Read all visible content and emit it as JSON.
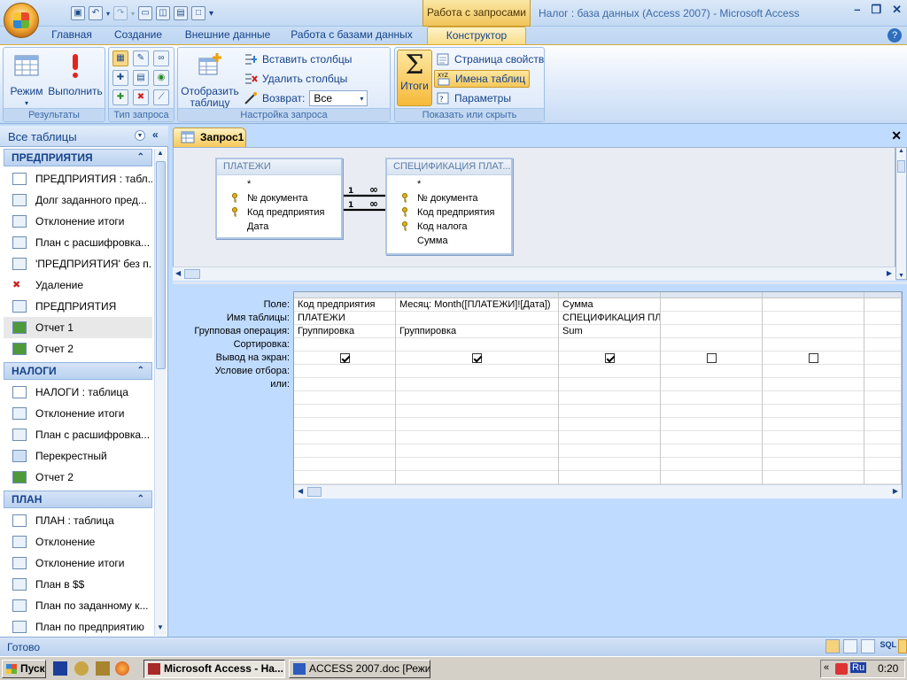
{
  "title_bar": {
    "context_tab": "Работа с запросами",
    "window_title": "Налог : база данных (Access 2007) - Microsoft Access"
  },
  "tabs": [
    {
      "label": "Главная"
    },
    {
      "label": "Создание"
    },
    {
      "label": "Внешние данные"
    },
    {
      "label": "Работа с базами данных"
    },
    {
      "label": "Конструктор",
      "active": true
    }
  ],
  "ribbon": {
    "results": {
      "label": "Результаты",
      "mode": "Режим",
      "run": "Выполнить"
    },
    "query_type": {
      "label": "Тип запроса"
    },
    "query_setup": {
      "label": "Настройка запроса",
      "show_table": "Отобразить таблицу",
      "insert_columns": "Вставить столбцы",
      "delete_columns": "Удалить столбцы",
      "return_label": "Возврат:",
      "return_value": "Все"
    },
    "show_hide": {
      "label": "Показать или скрыть",
      "totals": "Итоги",
      "property_sheet": "Страница свойств",
      "table_names": "Имена таблиц",
      "parameters": "Параметры"
    }
  },
  "nav": {
    "title": "Все таблицы",
    "sections": [
      {
        "name": "ПРЕДПРИЯТИЯ",
        "items": [
          {
            "label": "ПРЕДПРИЯТИЯ : табл...",
            "icon": "table"
          },
          {
            "label": "Долг заданного пред...",
            "icon": "query"
          },
          {
            "label": "Отклонение итоги",
            "icon": "query"
          },
          {
            "label": "План с расшифровка...",
            "icon": "query"
          },
          {
            "label": "'ПРЕДПРИЯТИЯ' без п...",
            "icon": "query"
          },
          {
            "label": "Удаление",
            "icon": "delete-query"
          },
          {
            "label": "ПРЕДПРИЯТИЯ",
            "icon": "form"
          },
          {
            "label": "Отчет 1",
            "icon": "report",
            "selected": true
          },
          {
            "label": "Отчет 2",
            "icon": "report"
          }
        ]
      },
      {
        "name": "НАЛОГИ",
        "items": [
          {
            "label": "НАЛОГИ : таблица",
            "icon": "table"
          },
          {
            "label": "Отклонение итоги",
            "icon": "query"
          },
          {
            "label": "План с расшифровка...",
            "icon": "query"
          },
          {
            "label": "Перекрестный",
            "icon": "crosstab"
          },
          {
            "label": "Отчет 2",
            "icon": "report"
          }
        ]
      },
      {
        "name": "ПЛАН",
        "items": [
          {
            "label": "ПЛАН : таблица",
            "icon": "table"
          },
          {
            "label": "Отклонение",
            "icon": "query"
          },
          {
            "label": "Отклонение итоги",
            "icon": "query"
          },
          {
            "label": "План в $$",
            "icon": "query"
          },
          {
            "label": "План по заданному к...",
            "icon": "query"
          },
          {
            "label": "План по предприятию",
            "icon": "query"
          },
          {
            "label": "План с расшифровка...",
            "icon": "query"
          }
        ]
      }
    ]
  },
  "document": {
    "tab": "Запрос1",
    "tables": [
      {
        "name": "ПЛАТЕЖИ",
        "fields": [
          "*",
          "№ документа",
          "Код предприятия",
          "Дата"
        ],
        "keys": [
          1,
          2
        ]
      },
      {
        "name": "СПЕЦИФИКАЦИЯ ПЛАТ...",
        "fields": [
          "*",
          "№ документа",
          "Код предприятия",
          "Код налога",
          "Сумма"
        ],
        "keys": [
          1,
          2,
          3
        ]
      }
    ],
    "relation_labels": {
      "one": "1",
      "many": "∞"
    },
    "grid": {
      "row_labels": [
        "Поле:",
        "Имя таблицы:",
        "Групповая операция:",
        "Сортировка:",
        "Вывод на экран:",
        "Условие отбора:",
        "или:"
      ],
      "columns": [
        {
          "field": "Код предприятия",
          "table": "ПЛАТЕЖИ",
          "group": "Группировка",
          "sort": "",
          "show": true
        },
        {
          "field": "Месяц: Month([ПЛАТЕЖИ]![Дата])",
          "table": "",
          "group": "Группировка",
          "sort": "",
          "show": true
        },
        {
          "field": "Сумма",
          "table": "СПЕЦИФИКАЦИЯ ПЛА",
          "group": "Sum",
          "sort": "",
          "show": true
        },
        {
          "field": "",
          "table": "",
          "group": "",
          "sort": "",
          "show": false
        },
        {
          "field": "",
          "table": "",
          "group": "",
          "sort": "",
          "show": false
        },
        {
          "field": "",
          "table": "",
          "group": "",
          "sort": "",
          "show": null
        }
      ]
    }
  },
  "status": {
    "text": "Готово"
  },
  "taskbar": {
    "start": "Пуск",
    "tasks": [
      {
        "label": "Microsoft Access - На...",
        "pressed": true
      },
      {
        "label": "ACCESS 2007.doc [Режим...",
        "pressed": false
      }
    ],
    "lang": "Ru",
    "clock": "0:20"
  }
}
